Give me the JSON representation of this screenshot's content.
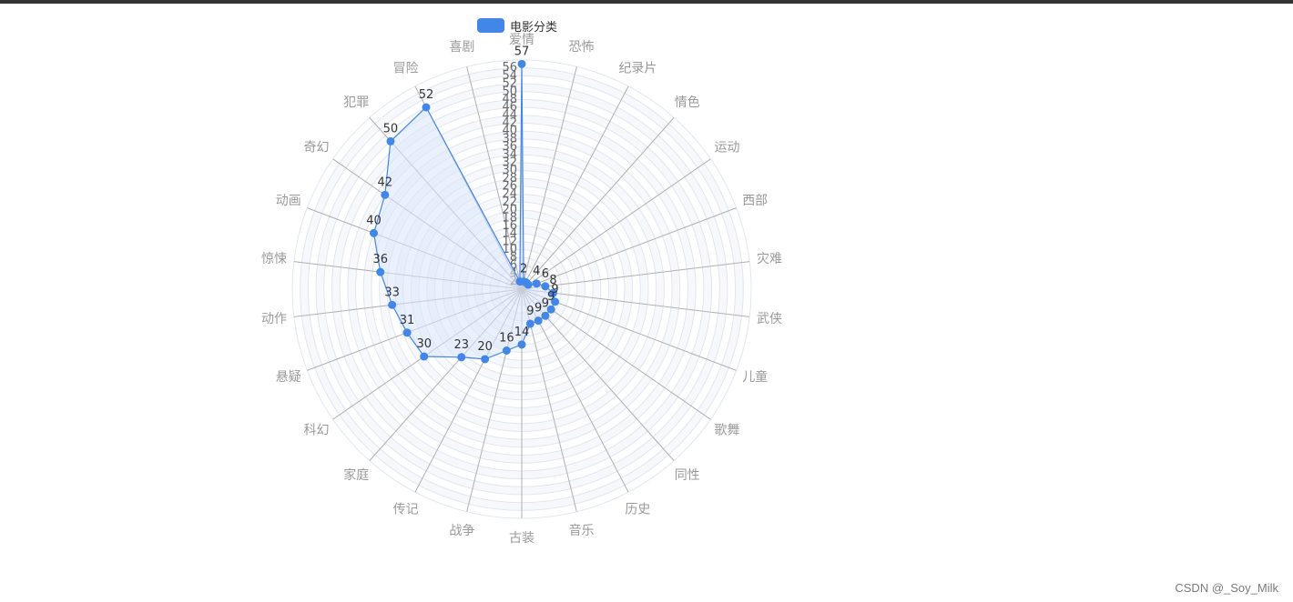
{
  "watermark": "CSDN @_Soy_Milk",
  "colors": {
    "series": "#4287e7",
    "area": "#dbe6fa",
    "split_area_a": "#f6f8fc",
    "split_area_b": "#ffffff",
    "split_line": "#e0e6f1",
    "axis_line": "#b0b0b0",
    "axis_label": "#9a9a9a"
  },
  "chart_data": {
    "type": "radar",
    "title": "",
    "legend": {
      "position": "top-center",
      "entries": [
        "电影分类"
      ]
    },
    "max": 58,
    "tick_step": 2,
    "tick_labels": [
      "2",
      "4",
      "6",
      "8",
      "10",
      "12",
      "14",
      "16",
      "18",
      "20",
      "22",
      "24",
      "26",
      "28",
      "30",
      "32",
      "34",
      "36",
      "38",
      "40",
      "42",
      "44",
      "46",
      "48",
      "50",
      "52",
      "54",
      "56"
    ],
    "categories": [
      "爱情",
      "恐怖",
      "纪录片",
      "情色",
      "运动",
      "西部",
      "灾难",
      "武侠",
      "儿童",
      "歌舞",
      "同性",
      "历史",
      "音乐",
      "古装",
      "战争",
      "传记",
      "家庭",
      "科幻",
      "悬疑",
      "动作",
      "惊悚",
      "动画",
      "奇幻",
      "犯罪",
      "冒险",
      "喜剧"
    ],
    "series": [
      {
        "name": "电影分类",
        "values": [
          57,
          2,
          2,
          2,
          2,
          4,
          6,
          8,
          9,
          9,
          9,
          9,
          9,
          14,
          16,
          20,
          23,
          30,
          31,
          33,
          36,
          40,
          42,
          50,
          52,
          2
        ],
        "labels": [
          "57",
          "2",
          "",
          "",
          "",
          "4",
          "6",
          "8",
          "9",
          "9",
          "9",
          "9",
          "9",
          "14",
          "16",
          "20",
          "23",
          "30",
          "31",
          "33",
          "36",
          "40",
          "42",
          "50",
          "52",
          ""
        ]
      }
    ]
  }
}
